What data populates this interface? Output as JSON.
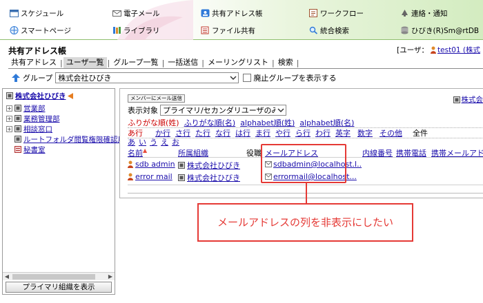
{
  "nav": {
    "items": [
      {
        "label": "スケジュール",
        "icon": "calendar-icon"
      },
      {
        "label": "電子メール",
        "icon": "mail-icon"
      },
      {
        "label": "共有アドレス帳",
        "icon": "address-book-icon"
      },
      {
        "label": "ワークフロー",
        "icon": "workflow-icon"
      },
      {
        "label": "連絡・通知",
        "icon": "notification-icon"
      },
      {
        "label": "スマートページ",
        "icon": "smartpage-icon"
      },
      {
        "label": "ライブラリ",
        "icon": "library-icon"
      },
      {
        "label": "ファイル共有",
        "icon": "file-share-icon"
      },
      {
        "label": "統合検索",
        "icon": "search-icon"
      },
      {
        "label": "ひびき(R)Sm@rtDB",
        "icon": "database-icon"
      }
    ]
  },
  "page": {
    "title": "共有アドレス帳",
    "user_prefix": "[ユーザ：",
    "user_name": "test01 (株式"
  },
  "tabs": [
    "共有アドレス",
    "ユーザ一覧",
    "グループ一覧",
    "一括送信",
    "メーリングリスト",
    "検索"
  ],
  "active_tab": 1,
  "group_row": {
    "label": "グループ",
    "selected": "株式会社ひびき",
    "checkbox_label": "廃止グループを表示する"
  },
  "tree": {
    "root": "株式会社ひびき",
    "items": [
      "営業部",
      "業務管理部",
      "相談窓口",
      "ルートフォルダ閲覧権限確認用",
      "秘書室"
    ],
    "primary_button": "プライマリ組織を表示"
  },
  "main": {
    "mail_button": "メンバーにメール送信",
    "right_link": "株式会",
    "display_target_label": "表示対象",
    "display_target_value": "プライマリ/セカンダリユーザのみ",
    "sort_options": [
      "ふりがな順(姓)",
      "ふりがな順(名)",
      "alphabet順(姓)",
      "alphabet順(名)"
    ],
    "index_row1": [
      "あ行",
      "か行",
      "さ行",
      "た行",
      "な行",
      "は行",
      "ま行",
      "や行",
      "ら行",
      "わ行",
      "英字",
      "数字",
      "その他",
      "全件"
    ],
    "index_row2": [
      "あ",
      "い",
      "う",
      "え",
      "お"
    ],
    "columns": [
      "名前",
      "所属組織",
      "役職",
      "メールアドレス",
      "内線番号",
      "携帯電話",
      "携帯メールアドレ"
    ],
    "rows": [
      {
        "name": "sdb admin",
        "org": "株式会社ひびき",
        "email": "sdbadmin@localhost.l.."
      },
      {
        "name": "error mail",
        "org": "株式会社ひびき",
        "email": "errormail@localhost..."
      }
    ]
  },
  "annotation": {
    "text": "メールアドレスの列を非表示にしたい",
    "color": "#e53935"
  }
}
